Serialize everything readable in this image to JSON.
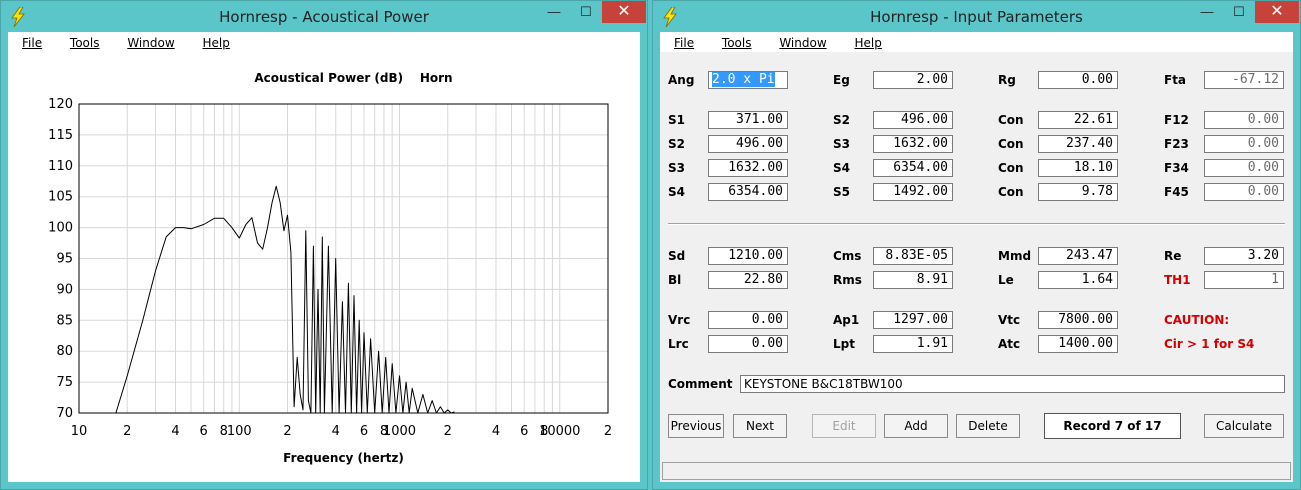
{
  "left_window": {
    "title": "Hornresp - Acoustical Power",
    "menu": [
      "File",
      "Tools",
      "Window",
      "Help"
    ],
    "controls": {
      "minimize": "—",
      "maximize": "☐",
      "close": "✕"
    }
  },
  "right_window": {
    "title": "Hornresp - Input Parameters",
    "menu": [
      "File",
      "Tools",
      "Window",
      "Help"
    ],
    "controls": {
      "minimize": "—",
      "maximize": "☐",
      "close": "✕"
    }
  },
  "chart_data": {
    "type": "line",
    "title": "Acoustical Power (dB)    Horn",
    "xlabel": "Frequency (hertz)",
    "ylabel": "",
    "x_scale": "log",
    "xlim": [
      10,
      20000
    ],
    "ylim": [
      70,
      120
    ],
    "x_tick_labels": [
      "10",
      "2",
      "4",
      "6",
      "8",
      "100",
      "2",
      "4",
      "6",
      "8",
      "1000",
      "2",
      "4",
      "6",
      "8",
      "10000",
      "2"
    ],
    "x_tick_values": [
      10,
      20,
      40,
      60,
      80,
      100,
      200,
      400,
      600,
      800,
      1000,
      2000,
      4000,
      6000,
      8000,
      10000,
      20000
    ],
    "y_ticks": [
      70,
      75,
      80,
      85,
      90,
      95,
      100,
      105,
      110,
      115,
      120
    ],
    "grid": true,
    "series": [
      {
        "x": [
          17,
          20,
          25,
          30,
          35,
          40,
          45,
          50,
          60,
          70,
          80,
          90,
          100,
          110,
          120,
          130,
          140,
          150,
          160,
          170,
          180,
          190,
          200,
          210,
          220,
          230,
          240,
          250,
          260,
          270,
          280,
          290,
          300,
          310,
          320,
          330,
          340,
          360,
          380,
          400,
          420,
          440,
          460,
          480,
          500,
          520,
          540,
          560,
          580,
          600,
          630,
          660,
          700,
          740,
          780,
          820,
          860,
          900,
          950,
          1000,
          1050,
          1100,
          1150,
          1200,
          1300,
          1400,
          1500,
          1600,
          1700,
          1800,
          1900,
          2000,
          2100,
          2200
        ],
        "y": [
          70,
          76,
          85,
          93,
          98.5,
          100,
          100,
          99.8,
          100.5,
          101.5,
          101.5,
          100,
          98.3,
          100.5,
          101.6,
          97.5,
          96.5,
          100,
          104,
          106.7,
          104,
          99.5,
          102,
          96,
          71,
          79,
          73,
          70.5,
          99.5,
          72,
          70,
          97,
          70,
          90,
          70,
          98.5,
          70,
          97,
          70,
          95,
          70,
          88,
          70,
          91,
          70,
          89,
          70,
          85,
          70,
          83,
          70,
          82,
          70,
          80,
          70,
          79,
          70,
          78,
          70,
          76,
          70,
          75,
          70,
          74,
          70,
          73,
          70,
          72,
          70,
          71,
          70,
          70.5,
          70,
          70.2
        ]
      }
    ]
  },
  "params": {
    "row0": {
      "ang_label": "Ang",
      "ang_value": "2.0 x Pi",
      "eg_label": "Eg",
      "eg_value": "2.00",
      "rg_label": "Rg",
      "rg_value": "0.00",
      "fta_label": "Fta",
      "fta_value": "-67.12"
    },
    "s_rows": [
      {
        "l1": "S1",
        "v1": "371.00",
        "l2": "S2",
        "v2": "496.00",
        "l3": "Con",
        "v3": "22.61",
        "l4": "F12",
        "v4": "0.00"
      },
      {
        "l1": "S2",
        "v1": "496.00",
        "l2": "S3",
        "v2": "1632.00",
        "l3": "Con",
        "v3": "237.40",
        "l4": "F23",
        "v4": "0.00"
      },
      {
        "l1": "S3",
        "v1": "1632.00",
        "l2": "S4",
        "v2": "6354.00",
        "l3": "Con",
        "v3": "18.10",
        "l4": "F34",
        "v4": "0.00"
      },
      {
        "l1": "S4",
        "v1": "6354.00",
        "l2": "S5",
        "v2": "1492.00",
        "l3": "Con",
        "v3": "9.78",
        "l4": "F45",
        "v4": "0.00"
      }
    ],
    "driver": {
      "sd_label": "Sd",
      "sd_value": "1210.00",
      "cms_label": "Cms",
      "cms_value": "8.83E-05",
      "mmd_label": "Mmd",
      "mmd_value": "243.47",
      "re_label": "Re",
      "re_value": "3.20",
      "bl_label": "Bl",
      "bl_value": "22.80",
      "rms_label": "Rms",
      "rms_value": "8.91",
      "le_label": "Le",
      "le_value": "1.64",
      "th1_label": "TH1",
      "th1_value": "1"
    },
    "chamber": {
      "vrc_label": "Vrc",
      "vrc_value": "0.00",
      "ap1_label": "Ap1",
      "ap1_value": "1297.00",
      "vtc_label": "Vtc",
      "vtc_value": "7800.00",
      "lrc_label": "Lrc",
      "lrc_value": "0.00",
      "lpt_label": "Lpt",
      "lpt_value": "1.91",
      "atc_label": "Atc",
      "atc_value": "1400.00",
      "caution_label": "CAUTION:",
      "caution_msg": "Cir > 1 for S4"
    },
    "comment_label": "Comment",
    "comment_value": "KEYSTONE B&C18TBW100"
  },
  "buttons": {
    "previous": "Previous",
    "next": "Next",
    "edit": "Edit",
    "add": "Add",
    "delete": "Delete",
    "record": "Record 7 of 17",
    "calculate": "Calculate"
  },
  "colors": {
    "chrome": "#5bc6c9",
    "close": "#c7423a",
    "caution": "#d40000",
    "selection": "#3399ff"
  }
}
